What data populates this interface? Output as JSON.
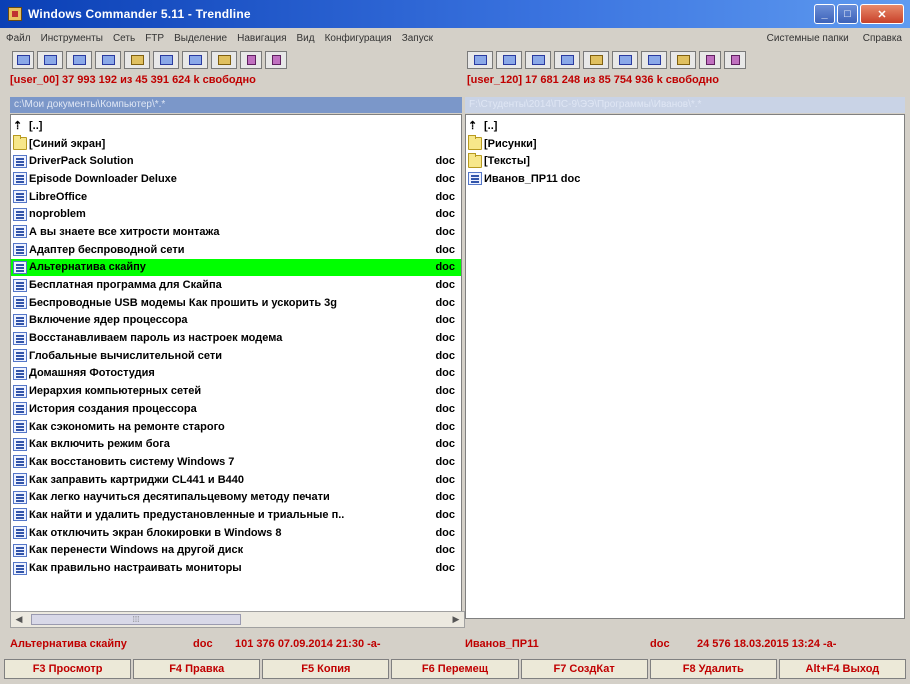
{
  "window": {
    "title": "Windows Commander 5.11 - Trendline"
  },
  "menu": {
    "items": [
      "Файл",
      "Инструменты",
      "Сеть",
      "FTP",
      "Выделение",
      "Навигация",
      "Вид",
      "Конфигурация",
      "Запуск"
    ],
    "right": [
      "Системные папки",
      "Справка"
    ]
  },
  "left": {
    "disk_info": "[user_00]  37 993 192 из 45 391 624 k свободно",
    "path": "c:\\Мои документы\\Компьютер\\*.*",
    "files": [
      {
        "name": "[..]",
        "ext": "",
        "icon": "up-icon"
      },
      {
        "name": "[Синий экран]",
        "ext": "",
        "icon": "folder-icon"
      },
      {
        "name": "DriverPack Solution",
        "ext": "doc",
        "icon": "doc-icon"
      },
      {
        "name": "Episode Downloader Deluxe",
        "ext": "doc",
        "icon": "doc-icon"
      },
      {
        "name": "LibreOffice",
        "ext": "doc",
        "icon": "doc-icon"
      },
      {
        "name": "noproblem",
        "ext": "doc",
        "icon": "doc-icon"
      },
      {
        "name": "А вы знаете все хитрости монтажа",
        "ext": "doc",
        "icon": "doc-icon"
      },
      {
        "name": "Адаптер беспроводной сети",
        "ext": "doc",
        "icon": "doc-icon"
      },
      {
        "name": "Альтернатива скайпу",
        "ext": "doc",
        "icon": "doc-icon",
        "selected": true
      },
      {
        "name": "Бесплатная программа для Скайпа",
        "ext": "doc",
        "icon": "doc-icon"
      },
      {
        "name": "Беспроводные USB модемы Как прошить и ускорить 3g",
        "ext": "doc",
        "icon": "doc-icon"
      },
      {
        "name": "Включение ядер процессора",
        "ext": "doc",
        "icon": "doc-icon"
      },
      {
        "name": "Восстанавливаем пароль из настроек модема",
        "ext": "doc",
        "icon": "doc-icon"
      },
      {
        "name": "Глобальные вычислительной сети",
        "ext": "doc",
        "icon": "doc-icon"
      },
      {
        "name": "Домашняя Фотостудия",
        "ext": "doc",
        "icon": "doc-icon"
      },
      {
        "name": "Иерархия компьютерных сетей",
        "ext": "doc",
        "icon": "doc-icon"
      },
      {
        "name": "История создания процессора",
        "ext": "doc",
        "icon": "doc-icon"
      },
      {
        "name": "Как  сэкономить на ремонте старого",
        "ext": "doc",
        "icon": "doc-icon"
      },
      {
        "name": "Как включить режим бога",
        "ext": "doc",
        "icon": "doc-icon"
      },
      {
        "name": "Как восстановить систему Windows 7",
        "ext": "doc",
        "icon": "doc-icon"
      },
      {
        "name": "Как заправить картриджи CL441 и B440",
        "ext": "doc",
        "icon": "doc-icon"
      },
      {
        "name": "Как легко научиться десятипальцевому методу печати",
        "ext": "doc",
        "icon": "doc-icon"
      },
      {
        "name": "Как найти и удалить предустановленные и триальные п..",
        "ext": "doc",
        "icon": "doc-icon"
      },
      {
        "name": "Как отключить экран блокировки в Windows 8",
        "ext": "doc",
        "icon": "doc-icon"
      },
      {
        "name": "Как перенести Windows на другой диск",
        "ext": "doc",
        "icon": "doc-icon"
      },
      {
        "name": "Как правильно настраивать мониторы",
        "ext": "doc",
        "icon": "doc-icon"
      }
    ],
    "status_name": "Альтернатива скайпу",
    "status_ext": "doc",
    "status_info": "101 376 07.09.2014 21:30 -a-"
  },
  "right": {
    "disk_info": "[user_120]  17 681 248 из 85 754 936 k свободно",
    "path": "F:\\Студенты\\2014\\ПС-9\\ЭЭ\\Программы\\Иванов\\*.*",
    "files": [
      {
        "name": "[..]",
        "ext": "",
        "icon": "up-icon"
      },
      {
        "name": "[Рисунки]",
        "ext": "",
        "icon": "folder-icon"
      },
      {
        "name": "[Тексты]",
        "ext": "",
        "icon": "folder-icon"
      },
      {
        "name": "Иванов_ПР11 doc",
        "ext": "",
        "icon": "doc-icon"
      }
    ],
    "status_name": "Иванов_ПР11",
    "status_ext": "doc",
    "status_info": "24 576 18.03.2015 13:24 -a-"
  },
  "fkeys": [
    "F3 Просмотр",
    "F4 Правка",
    "F5 Копия",
    "F6 Перемещ",
    "F7 СоздКат",
    "F8 Удалить",
    "Alt+F4 Выход"
  ],
  "colors": {
    "selection": "#00ff00",
    "accent_text": "#c00000",
    "path_bar": "#7b97c9",
    "titlebar": "#0a3fb5"
  }
}
